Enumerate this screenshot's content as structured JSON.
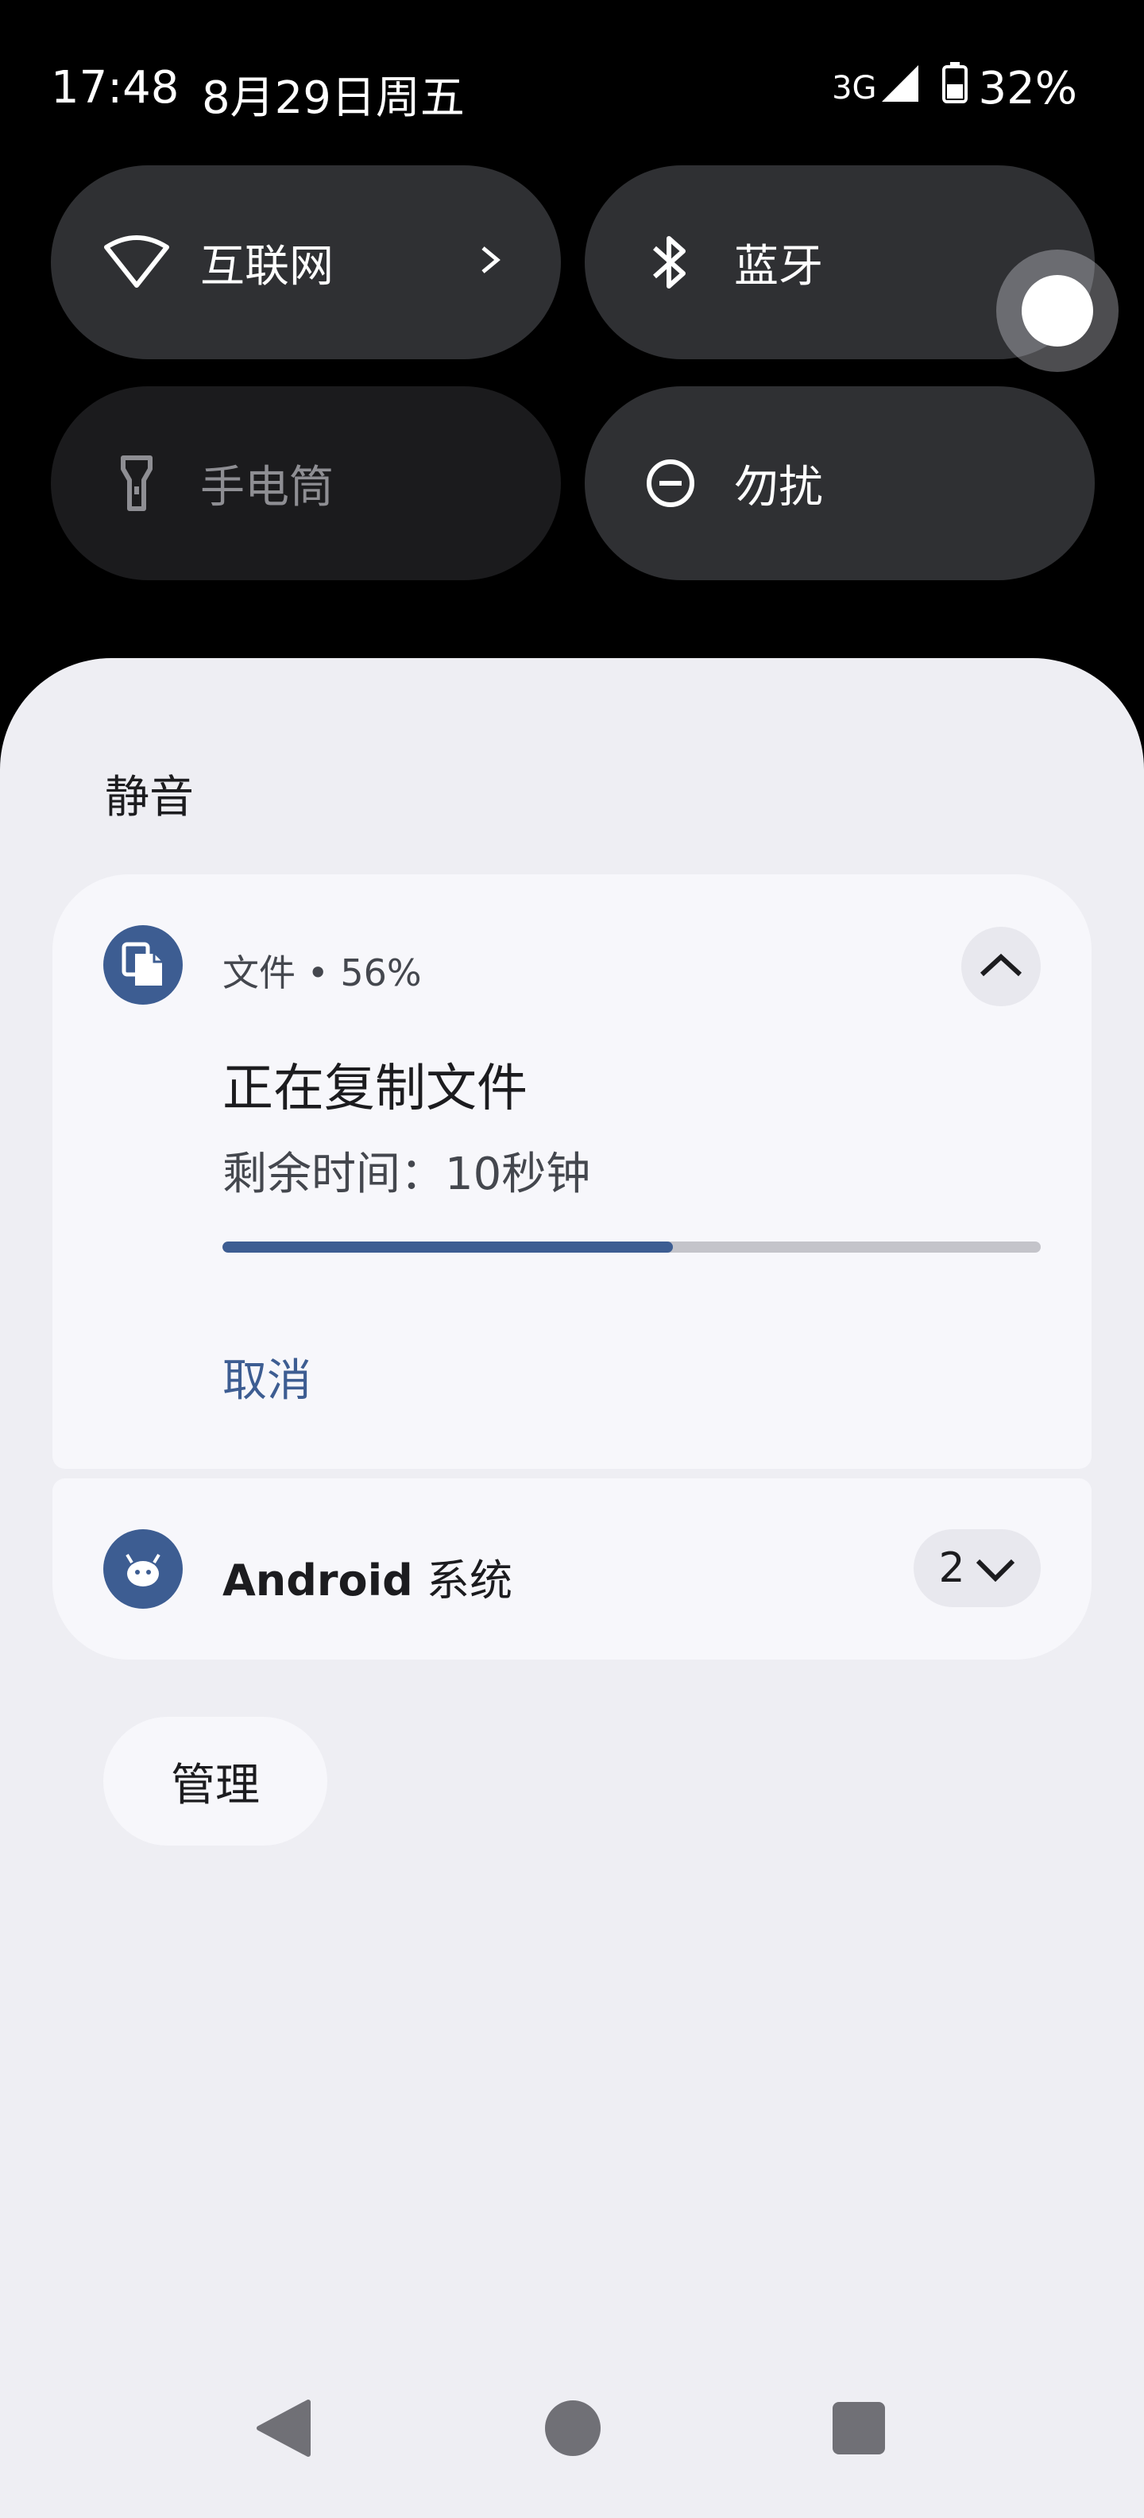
{
  "status_bar": {
    "time": "17:48",
    "date": "8月29日周五",
    "network": "3G",
    "battery": "32%"
  },
  "quick_tiles": [
    {
      "label": "互联网",
      "icon": "wifi-icon",
      "active": true
    },
    {
      "label": "蓝牙",
      "icon": "bluetooth-icon",
      "active": true
    },
    {
      "label": "手电筒",
      "icon": "flashlight-icon",
      "active": false
    },
    {
      "label": "勿扰",
      "icon": "do-not-disturb-icon",
      "active": true
    }
  ],
  "section": {
    "title": "静音"
  },
  "file_notification": {
    "app": "文件",
    "meta": "文件 • 56%",
    "title": "正在复制文件",
    "text": "剩余时间：10秒钟",
    "progress": 0.55,
    "action": "取消"
  },
  "system_notification": {
    "name_latin": "Android",
    "name_cn": "系统",
    "count": "2"
  },
  "manage_label": "管理",
  "colors": {
    "accent": "#3d5d92",
    "sheet_bg": "#eeeef3",
    "card_bg": "#f7f7fb",
    "tile_active": "#2f3033",
    "tile_inactive": "#1b1b1d"
  }
}
